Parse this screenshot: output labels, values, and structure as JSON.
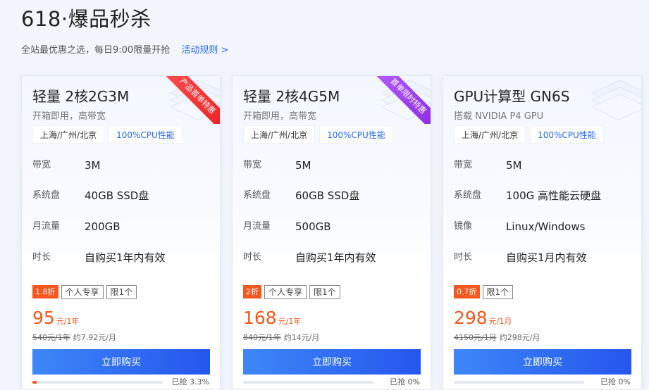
{
  "header": {
    "title": "618·爆品秒杀",
    "subtitle": "全站最优惠之选，每日9:00限量开抢",
    "rules_link": "活动规则 >"
  },
  "cards": [
    {
      "title": "轻量 2核2G3M",
      "desc": "开箱即用，高带宽",
      "ribbon": "产品首单特惠",
      "ribbon_color": "#e8222a",
      "tags": [
        "上海/广州/北京",
        "100%CPU性能"
      ],
      "specs": [
        {
          "label": "带宽",
          "value": "3M"
        },
        {
          "label": "系统盘",
          "value": "40GB SSD盘"
        },
        {
          "label": "月流量",
          "value": "200GB"
        },
        {
          "label": "时长",
          "value": "自购买1年内有效"
        }
      ],
      "discount": "1.8折",
      "badges": [
        "个人专享",
        "限1个"
      ],
      "price": "95",
      "price_unit": "元/1年",
      "old_price": "540元/1年",
      "monthly": "约7.92元/月",
      "buy_label": "立即购买",
      "progress": 3.3,
      "sold": "已抢 3.3%"
    },
    {
      "title": "轻量 2核4G5M",
      "desc": "开箱即用，高带宽",
      "ribbon": "首单限时特惠",
      "ribbon_color": "#8a2be2",
      "tags": [
        "上海/广州/北京",
        "100%CPU性能"
      ],
      "specs": [
        {
          "label": "带宽",
          "value": "5M"
        },
        {
          "label": "系统盘",
          "value": "60GB SSD盘"
        },
        {
          "label": "月流量",
          "value": "500GB"
        },
        {
          "label": "时长",
          "value": "自购买1年内有效"
        }
      ],
      "discount": "2折",
      "badges": [
        "个人专享",
        "限1个"
      ],
      "price": "168",
      "price_unit": "元/1年",
      "old_price": "840元/1年",
      "monthly": "约14元/月",
      "buy_label": "立即购买",
      "progress": 0,
      "sold": "已抢 0%"
    },
    {
      "title": "GPU计算型 GN6S",
      "desc": "搭载 NVIDIA P4 GPU",
      "tags": [
        "上海/广州/北京",
        "100%CPU性能"
      ],
      "specs": [
        {
          "label": "带宽",
          "value": "5M"
        },
        {
          "label": "系统盘",
          "value": "100G 高性能云硬盘"
        },
        {
          "label": "镜像",
          "value": "Linux/Windows"
        },
        {
          "label": "时长",
          "value": "自购买1月内有效"
        }
      ],
      "discount": "0.7折",
      "badges": [
        "限1个"
      ],
      "price": "298",
      "price_unit": "元/1月",
      "old_price": "4150元/1月",
      "monthly": "约298元/月",
      "buy_label": "立即购买",
      "progress": 0,
      "sold": "已抢 0%"
    }
  ]
}
